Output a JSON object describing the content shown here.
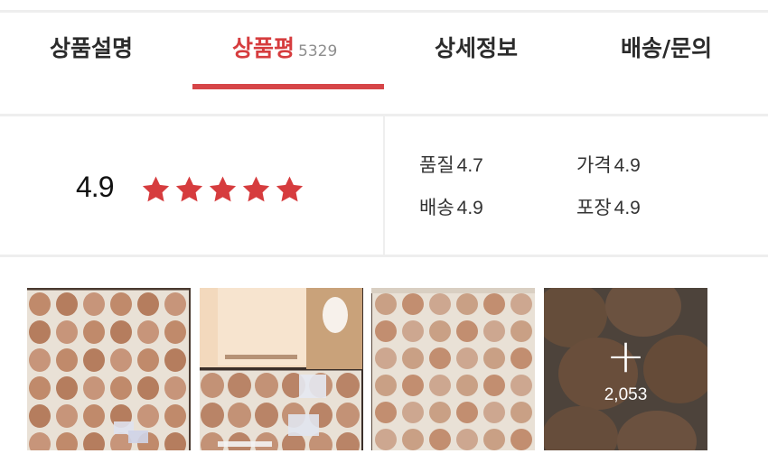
{
  "tabs": [
    {
      "label": "상품설명",
      "count": ""
    },
    {
      "label": "상품평",
      "count": "5329"
    },
    {
      "label": "상세정보",
      "count": ""
    },
    {
      "label": "배송/문의",
      "count": ""
    }
  ],
  "active_tab": 1,
  "rating": {
    "average": "4.9",
    "stars_filled": 5,
    "stars_total": 5,
    "star_color": "#d63c3e",
    "metrics": [
      {
        "label": "품질",
        "value": "4.7"
      },
      {
        "label": "가격",
        "value": "4.9"
      },
      {
        "label": "배송",
        "value": "4.9"
      },
      {
        "label": "포장",
        "value": "4.9"
      }
    ]
  },
  "photos": {
    "items": [
      {
        "subject": "eggs in tray"
      },
      {
        "subject": "eggs with paper insert"
      },
      {
        "subject": "eggs in tray"
      },
      {
        "subject": "eggs close-up"
      }
    ],
    "more_icon": "plus-icon",
    "more_count": "2,053"
  },
  "colors": {
    "accent": "#d63c3e",
    "divider": "#eeeeee"
  }
}
